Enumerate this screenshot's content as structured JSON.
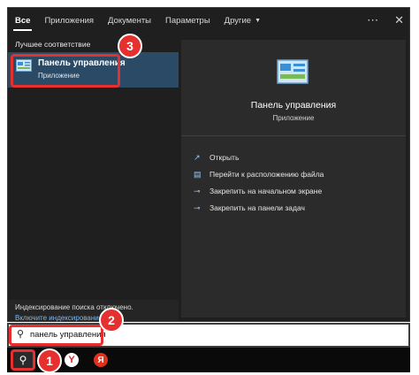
{
  "tabs": [
    {
      "label": "Все",
      "active": true
    },
    {
      "label": "Приложения"
    },
    {
      "label": "Документы"
    },
    {
      "label": "Параметры"
    },
    {
      "label": "Другие",
      "dropdown": true
    }
  ],
  "window_icons": {
    "more": "⋯",
    "close": "✕"
  },
  "left_panel": {
    "section_label": "Лучшее соответствие",
    "best_match": {
      "title": "Панель управления",
      "subtitle": "Приложение"
    },
    "indexing_title": "Индексирование поиска отключено.",
    "indexing_link": "Включите индексирование."
  },
  "right_panel": {
    "title": "Панель управления",
    "subtitle": "Приложение",
    "actions": [
      {
        "label": "Открыть",
        "icon": "open-icon"
      },
      {
        "label": "Перейти к расположению файла",
        "icon": "file-location-icon"
      },
      {
        "label": "Закрепить на начальном экране",
        "icon": "pin-start-icon"
      },
      {
        "label": "Закрепить на панели задач",
        "icon": "pin-taskbar-icon"
      }
    ]
  },
  "search": {
    "value": "панель управления"
  },
  "taskbar": {
    "app1_letter": "Y",
    "app2_letter": "Я"
  },
  "badges": [
    "1",
    "2",
    "3"
  ],
  "colors": {
    "accent_red": "#e5302f",
    "selection": "#2b4a66",
    "background": "#1f1f1f"
  }
}
